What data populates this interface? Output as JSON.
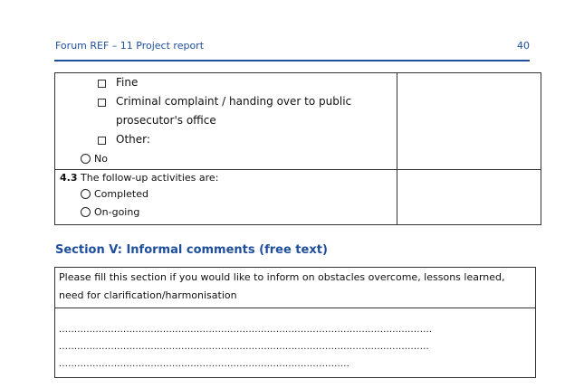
{
  "header": {
    "title": "Forum REF – 11 Project report",
    "page_number": "40"
  },
  "table1": {
    "sanction_options": [
      {
        "line1": "Fine",
        "line2": ""
      },
      {
        "line1": "Criminal complaint / handing over to public",
        "line2": "prosecutor's office"
      },
      {
        "line1": "Other:",
        "line2": ""
      }
    ],
    "no_label": "No",
    "q43_number": "4.3",
    "q43_text": "The follow-up activities are:",
    "followup_options": [
      "Completed",
      "On-going"
    ]
  },
  "section5": {
    "title": "Section V: Informal comments (free text)",
    "instruction": "Please fill this section if you would like to inform on obstacles overcome, lessons learned, need for clarification/harmonisation",
    "dotted_lines": [
      "..........................................................................................................................",
      ".........................................................................................................................",
      "..............................................................................................."
    ]
  }
}
